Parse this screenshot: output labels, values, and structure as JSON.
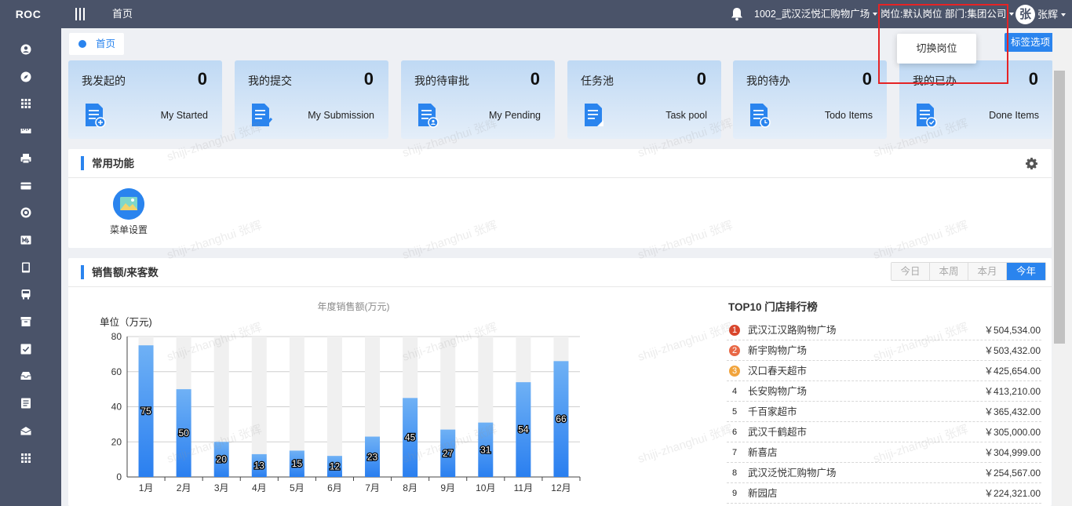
{
  "topbar": {
    "logo": "ROC",
    "home_label": "首页",
    "store_selector": "1002_武汉泛悦汇购物广场",
    "position_selector": "岗位:默认岗位 部门:集团公司",
    "avatar_char": "张",
    "user_name": "张辉"
  },
  "sidebar": {
    "icons": [
      "user-icon",
      "compass-icon",
      "grid-icon",
      "ruler-icon",
      "printer-icon",
      "card-icon",
      "target-icon",
      "chart-icon",
      "tablet-icon",
      "bus-icon",
      "archive-icon",
      "check-icon",
      "inbox-icon",
      "list-icon",
      "mail-icon",
      "apps-icon"
    ]
  },
  "tabs": {
    "home": "首页",
    "tag_options": "标签选项"
  },
  "popup": {
    "switch_position": "切换岗位"
  },
  "cards": [
    {
      "title": "我发起的",
      "count": "0",
      "sub": "My Started"
    },
    {
      "title": "我的提交",
      "count": "0",
      "sub": "My Submission"
    },
    {
      "title": "我的待审批",
      "count": "0",
      "sub": "My Pending"
    },
    {
      "title": "任务池",
      "count": "0",
      "sub": "Task pool"
    },
    {
      "title": "我的待办",
      "count": "0",
      "sub": "Todo Items"
    },
    {
      "title": "我的已办",
      "count": "0",
      "sub": "Done Items"
    }
  ],
  "common_functions": {
    "title": "常用功能",
    "items": [
      {
        "label": "菜单设置"
      }
    ]
  },
  "sales": {
    "title": "销售额/来客数",
    "ranges": [
      "今日",
      "本周",
      "本月",
      "今年"
    ],
    "active_range": "今年"
  },
  "chart_data": {
    "type": "bar",
    "title": "年度销售额(万元)",
    "ylabel": "单位（万元)",
    "categories": [
      "1月",
      "2月",
      "3月",
      "4月",
      "5月",
      "6月",
      "7月",
      "8月",
      "9月",
      "10月",
      "11月",
      "12月"
    ],
    "values": [
      75,
      50,
      20,
      13,
      15,
      12,
      23,
      45,
      27,
      31,
      54,
      66
    ],
    "ylim": [
      0,
      80
    ],
    "yticks": [
      0,
      20,
      40,
      60,
      80
    ],
    "data_labels": true,
    "grid": true,
    "colors": {
      "bar_top": "#6fb1f5",
      "bar_bottom": "#2a7ff0",
      "background_bar": "#f0f0f0"
    }
  },
  "ranking": {
    "title": "TOP10 门店排行榜",
    "items": [
      {
        "rank": "1",
        "name": "武汉江汉路购物广场",
        "value": "￥504,534.00"
      },
      {
        "rank": "2",
        "name": "新宇购物广场",
        "value": "￥503,432.00"
      },
      {
        "rank": "3",
        "name": "汉口春天超市",
        "value": "￥425,654.00"
      },
      {
        "rank": "4",
        "name": "长安购物广场",
        "value": "￥413,210.00"
      },
      {
        "rank": "5",
        "name": "千百家超市",
        "value": "￥365,432.00"
      },
      {
        "rank": "6",
        "name": "武汉千鹤超市",
        "value": "￥305,000.00"
      },
      {
        "rank": "7",
        "name": "新喜店",
        "value": "￥304,999.00"
      },
      {
        "rank": "8",
        "name": "武汉泛悦汇购物广场",
        "value": "￥254,567.00"
      },
      {
        "rank": "9",
        "name": "新园店",
        "value": "￥224,321.00"
      }
    ]
  },
  "watermark": "shiji-zhanghui 张辉",
  "colors": {
    "accent": "#2a84ee",
    "topbar": "#4a5369",
    "highlight": "#e52325"
  }
}
